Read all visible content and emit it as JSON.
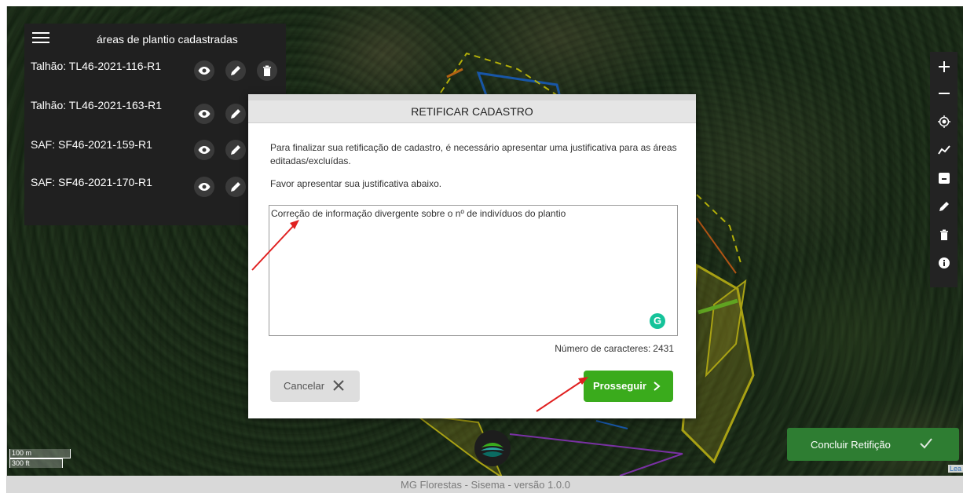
{
  "panel": {
    "title": "áreas de plantio cadastradas",
    "items": [
      {
        "label": "Talhão: TL46-2021-116-R1"
      },
      {
        "label": "Talhão: TL46-2021-163-R1"
      },
      {
        "label": "SAF: SF46-2021-159-R1"
      },
      {
        "label": "SAF: SF46-2021-170-R1"
      }
    ]
  },
  "map_controls": [
    "zoom-in-icon",
    "zoom-out-icon",
    "locate-icon",
    "polyline-icon",
    "archive-icon",
    "pencil-icon",
    "trash-icon",
    "info-icon"
  ],
  "modal": {
    "title": "RETIFICAR CADASTRO",
    "paragraph1": "Para finalizar sua retificação de cadastro, é necessário apresentar uma justificativa para as áreas editadas/excluídas.",
    "paragraph2": "Favor apresentar sua justificativa abaixo.",
    "textarea_value": "Correção de informação divergente sobre o nº de indivíduos do plantio",
    "char_count_label": "Número de caracteres:",
    "char_count_value": "2431",
    "cancel_label": "Cancelar",
    "proceed_label": "Prosseguir"
  },
  "conclude_label": "Concluir Retifição",
  "scale": {
    "metric": "100 m",
    "imperial": "300 ft"
  },
  "attribution": "Lea",
  "footer": "MG Florestas - Sisema - versão 1.0.0",
  "colors": {
    "panel_bg": "#202020",
    "proceed": "#3aab1c",
    "conclude": "#2e7d32",
    "grammarly": "#15c39a",
    "annotation_arrow": "#e02020"
  }
}
